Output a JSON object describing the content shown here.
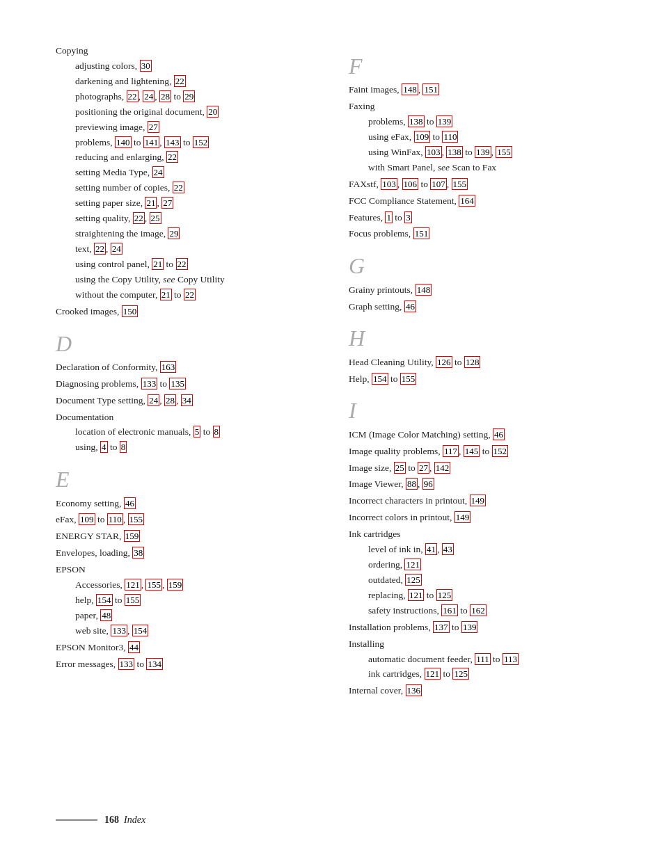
{
  "page": {
    "footer": {
      "page_number": "168",
      "label": "Index"
    }
  },
  "left_col": {
    "sections": [
      {
        "type": "top-level",
        "text": "Copying",
        "sub": [
          {
            "text": "adjusting colors,",
            "refs": [
              "30"
            ]
          },
          {
            "text": "darkening and lightening,",
            "refs": [
              "22"
            ]
          },
          {
            "text": "photographs,",
            "refs": [
              "22",
              "24",
              "28"
            ],
            "extra": " to ",
            "extra_ref": "29"
          },
          {
            "text": "positioning the original document,",
            "refs": [
              "20"
            ]
          },
          {
            "text": "previewing image,",
            "refs": [
              "27"
            ]
          },
          {
            "text": "problems,",
            "refs": [
              "140"
            ],
            "extra": " to ",
            "extra_ref2": "141",
            "refs2": [
              "143"
            ],
            "extra3": " to ",
            "extra_ref3": "152"
          },
          {
            "text": "reducing and enlarging,",
            "refs": [
              "22"
            ]
          },
          {
            "text": "setting Media Type,",
            "refs": [
              "24"
            ]
          },
          {
            "text": "setting number of copies,",
            "refs": [
              "22"
            ]
          },
          {
            "text": "setting paper size,",
            "refs": [
              "21",
              "27"
            ]
          },
          {
            "text": "setting quality,",
            "refs": [
              "22",
              "25"
            ]
          },
          {
            "text": "straightening the image,",
            "refs": [
              "29"
            ]
          },
          {
            "text": "text,",
            "refs": [
              "22",
              "24"
            ]
          },
          {
            "text": "using control panel,",
            "refs": [
              "21"
            ],
            "extra": " to ",
            "extra_ref": "22"
          },
          {
            "text": "using the Copy Utility, <em>see</em> Copy Utility"
          },
          {
            "text": "without the computer,",
            "refs": [
              "21"
            ],
            "extra": " to ",
            "extra_ref": "22"
          }
        ]
      },
      {
        "type": "top-level",
        "text": "Crooked images,",
        "refs": [
          "150"
        ]
      }
    ]
  },
  "left_col_d": {
    "letter": "D",
    "entries": [
      {
        "text": "Declaration of Conformity,",
        "refs": [
          "163"
        ]
      },
      {
        "text": "Diagnosing problems,",
        "refs": [
          "133"
        ],
        "extra": " to ",
        "extra_ref": "135"
      },
      {
        "text": "Document Type setting,",
        "refs": [
          "24",
          "28",
          "34"
        ]
      },
      {
        "text": "Documentation",
        "sub": [
          {
            "text": "location of electronic manuals,",
            "refs": [
              "5"
            ],
            "extra": " to ",
            "extra_ref": "8"
          },
          {
            "text": "using,",
            "refs": [
              "4"
            ],
            "extra": " to ",
            "extra_ref": "8"
          }
        ]
      }
    ]
  },
  "left_col_e": {
    "letter": "E",
    "entries": [
      {
        "text": "Economy setting,",
        "refs": [
          "46"
        ]
      },
      {
        "text": "eFax,",
        "refs": [
          "109"
        ],
        "extra": " to ",
        "extra_ref": "110",
        "refs2": [
          "155"
        ]
      },
      {
        "text": "ENERGY STAR,",
        "refs": [
          "159"
        ]
      },
      {
        "text": "Envelopes, loading,",
        "refs": [
          "38"
        ]
      },
      {
        "text": "EPSON",
        "sub": [
          {
            "text": "Accessories,",
            "refs": [
              "121",
              "155",
              "159"
            ]
          },
          {
            "text": "help,",
            "refs": [
              "154"
            ],
            "extra": " to ",
            "extra_ref": "155"
          },
          {
            "text": "paper,",
            "refs": [
              "48"
            ]
          },
          {
            "text": "web site,",
            "refs": [
              "133",
              "154"
            ]
          }
        ]
      },
      {
        "text": "EPSON Monitor3,",
        "refs": [
          "44"
        ]
      },
      {
        "text": "Error messages,",
        "refs": [
          "133"
        ],
        "extra": " to ",
        "extra_ref": "134"
      }
    ]
  },
  "right_col_f": {
    "letter": "F",
    "entries": [
      {
        "text": "Faint images,",
        "refs": [
          "148",
          "151"
        ]
      },
      {
        "text": "Faxing",
        "sub": [
          {
            "text": "problems,",
            "refs": [
              "138"
            ],
            "extra": " to ",
            "extra_ref": "139"
          },
          {
            "text": "using eFax,",
            "refs": [
              "109"
            ],
            "extra": " to ",
            "extra_ref": "110"
          },
          {
            "text": "using WinFax,",
            "refs": [
              "103",
              "138"
            ],
            "extra": " to ",
            "extra_ref": "139",
            "refs2": [
              "155"
            ]
          },
          {
            "text": "with Smart Panel, <em>see</em> Scan to Fax"
          }
        ]
      },
      {
        "text": "FAXstf,",
        "refs": [
          "103",
          "106"
        ],
        "extra": " to ",
        "extra_ref": "107",
        "refs2": [
          "155"
        ]
      },
      {
        "text": "FCC Compliance Statement,",
        "refs": [
          "164"
        ]
      },
      {
        "text": "Features,",
        "refs": [
          "1"
        ],
        "extra": " to ",
        "extra_ref": "3"
      },
      {
        "text": "Focus problems,",
        "refs": [
          "151"
        ]
      }
    ]
  },
  "right_col_g": {
    "letter": "G",
    "entries": [
      {
        "text": "Grainy printouts,",
        "refs": [
          "148"
        ]
      },
      {
        "text": "Graph setting,",
        "refs": [
          "46"
        ]
      }
    ]
  },
  "right_col_h": {
    "letter": "H",
    "entries": [
      {
        "text": "Head Cleaning Utility,",
        "refs": [
          "126"
        ],
        "extra": " to ",
        "extra_ref": "128"
      },
      {
        "text": "Help,",
        "refs": [
          "154"
        ],
        "extra": " to ",
        "extra_ref": "155"
      }
    ]
  },
  "right_col_i": {
    "letter": "I",
    "entries": [
      {
        "text": "ICM (Image Color Matching) setting,",
        "refs": [
          "46"
        ]
      },
      {
        "text": "Image quality problems,",
        "refs": [
          "117",
          "145"
        ],
        "extra": " to ",
        "extra_ref": "152"
      },
      {
        "text": "Image size,",
        "refs": [
          "25"
        ],
        "extra": " to ",
        "extra_ref": "27",
        "refs2": [
          "142"
        ]
      },
      {
        "text": "Image Viewer,",
        "refs": [
          "88",
          "96"
        ]
      },
      {
        "text": "Incorrect characters in printout,",
        "refs": [
          "149"
        ]
      },
      {
        "text": "Incorrect colors in printout,",
        "refs": [
          "149"
        ]
      },
      {
        "text": "Ink cartridges",
        "sub": [
          {
            "text": "level of ink in,",
            "refs": [
              "41",
              "43"
            ]
          },
          {
            "text": "ordering,",
            "refs": [
              "121"
            ]
          },
          {
            "text": "outdated,",
            "refs": [
              "125"
            ]
          },
          {
            "text": "replacing,",
            "refs": [
              "121"
            ],
            "extra": " to ",
            "extra_ref": "125"
          },
          {
            "text": "safety instructions,",
            "refs": [
              "161"
            ],
            "extra": " to ",
            "extra_ref": "162"
          }
        ]
      },
      {
        "text": "Installation problems,",
        "refs": [
          "137"
        ],
        "extra": " to ",
        "extra_ref": "139"
      },
      {
        "text": "Installing",
        "sub": [
          {
            "text": "automatic document feeder,",
            "refs": [
              "111"
            ],
            "extra": " to ",
            "extra_ref": "113"
          },
          {
            "text": "ink cartridges,",
            "refs": [
              "121"
            ],
            "extra": " to ",
            "extra_ref": "125"
          }
        ]
      },
      {
        "text": "Internal cover,",
        "refs": [
          "136"
        ]
      }
    ]
  }
}
